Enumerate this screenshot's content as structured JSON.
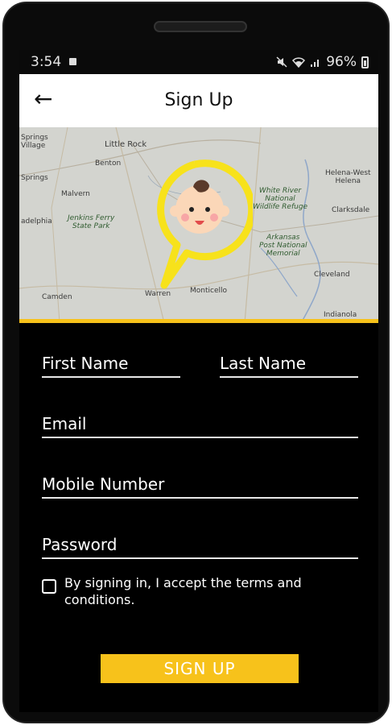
{
  "status_bar": {
    "time": "3:54",
    "battery": "96%",
    "icons": [
      "video-record-icon",
      "mute-icon",
      "wifi-icon",
      "signal-icon",
      "battery-icon"
    ]
  },
  "header": {
    "back_icon": "arrow-left-icon",
    "title": "Sign Up"
  },
  "map": {
    "labels": [
      "Little Rock",
      "Benton",
      "Malvern",
      "Jenkins Ferry\nState Park",
      "Springs\nVillage",
      "Springs",
      "adelphia",
      "Camden",
      "Warren",
      "Monticello",
      "White River\nNational\nWildlife Refuge",
      "Arkansas\nPost National\nMemorial",
      "Helena-West\nHelena",
      "Clarksdale",
      "Cleveland",
      "Indianola"
    ],
    "accent_color": "#f7c21b",
    "marker_icon": "baby-face-location-icon"
  },
  "form": {
    "first_name_placeholder": "First Name",
    "last_name_placeholder": "Last Name",
    "email_placeholder": "Email",
    "mobile_placeholder": "Mobile Number",
    "password_placeholder": "Password",
    "terms_text": "By signing in, I accept the terms and conditions.",
    "terms_checked": false,
    "submit_label": "SIGN UP"
  },
  "colors": {
    "background": "#000000",
    "accent": "#f7c21b",
    "text": "#ffffff"
  }
}
